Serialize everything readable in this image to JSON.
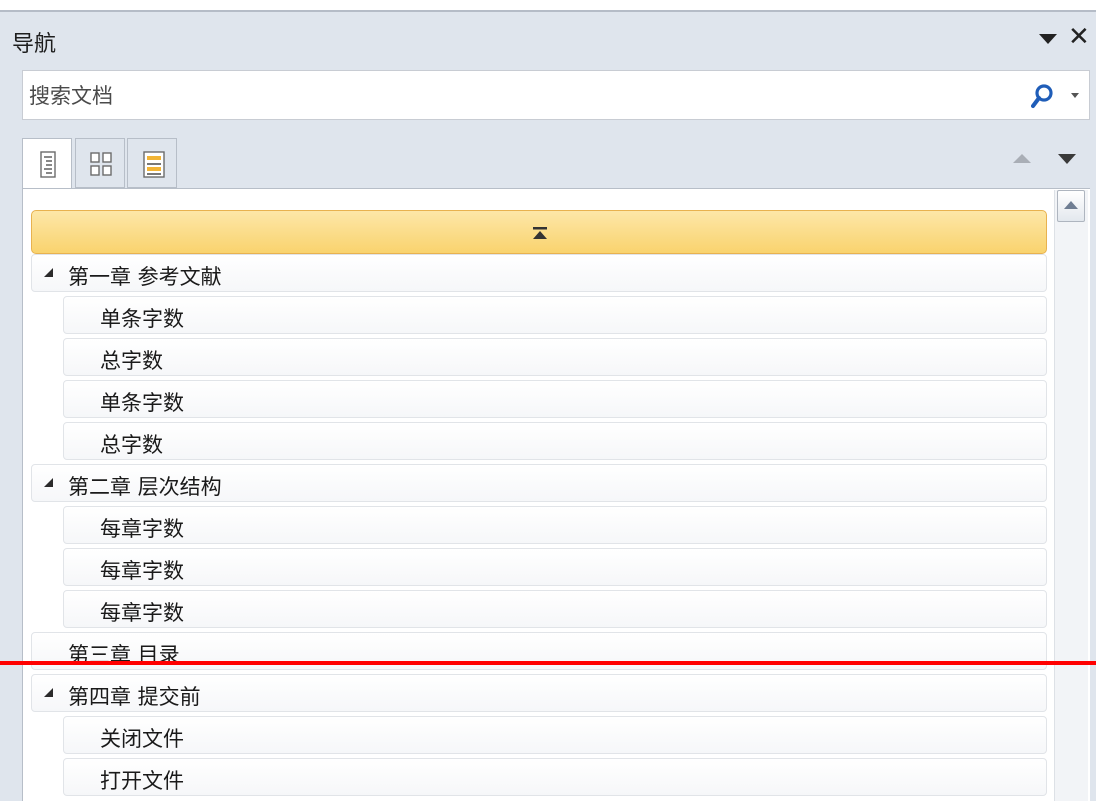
{
  "panel": {
    "title": "导航",
    "close_glyph": "✕"
  },
  "search": {
    "placeholder": "搜索文档"
  },
  "tabs": [
    {
      "icon": "headings-view-icon",
      "active": true
    },
    {
      "icon": "pages-thumbnail-icon",
      "active": false
    },
    {
      "icon": "search-results-icon",
      "active": false
    }
  ],
  "outline": {
    "items": [
      {
        "level": 1,
        "label": "第一章 参考文献",
        "expanded": true
      },
      {
        "level": 2,
        "label": "单条字数"
      },
      {
        "level": 2,
        "label": "总字数"
      },
      {
        "level": 2,
        "label": "单条字数"
      },
      {
        "level": 2,
        "label": "总字数"
      },
      {
        "level": 1,
        "label": "第二章 层次结构",
        "expanded": true
      },
      {
        "level": 2,
        "label": "每章字数"
      },
      {
        "level": 2,
        "label": "每章字数"
      },
      {
        "level": 2,
        "label": "每章字数"
      },
      {
        "level": 1,
        "label": "第三章 目录",
        "expanded": null
      },
      {
        "level": 1,
        "label": "第四章 提交前",
        "expanded": true
      },
      {
        "level": 2,
        "label": "关闭文件"
      },
      {
        "level": 2,
        "label": "打开文件"
      }
    ]
  },
  "colors": {
    "accent_highlight": "#f9d36e",
    "annotation_line": "#ff0000",
    "panel_bg": "#dfe5ed"
  }
}
